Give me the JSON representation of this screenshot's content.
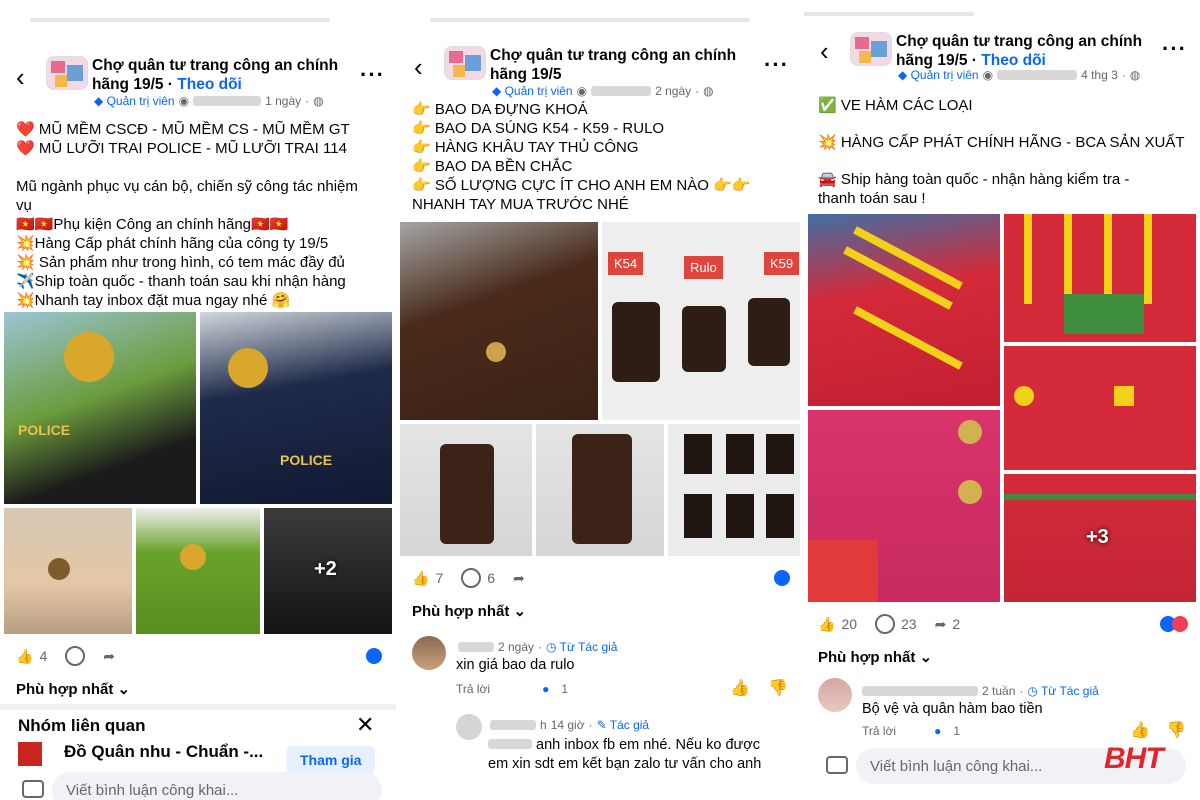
{
  "posts": [
    {
      "group_name_line1": "Chợ quân tư trang công an chính",
      "group_name_line2": "hãng 19/5",
      "follow": "Theo dõi",
      "admin": "Quản trị viên",
      "time": "1 ngày",
      "text": [
        "❤️ MŨ MỀM CSCĐ - MŨ MỀM CS - MŨ MỀM GT",
        "❤️ MŨ LƯỠI TRAI POLICE - MŨ LƯỠI TRAI 114",
        "",
        "Mũ ngành phục vụ cán bộ, chiến sỹ công tác nhiệm",
        "vụ",
        "🇻🇳🇻🇳Phụ kiện Công an chính hãng🇻🇳🇻🇳",
        "💥Hàng Cấp phát chính hãng của công ty 19/5",
        "💥 Sản phẩm như trong hình, có tem mác đầy đủ",
        "✈️Ship toàn quốc - thanh toán sau khi nhận hàng",
        "💥Nhanh tay inbox đặt mua ngay nhé 🤗"
      ],
      "extra_photos": "+2",
      "likes": "4",
      "sort": "Phù hợp nhất",
      "related_title": "Nhóm liên quan",
      "related_group": "Đồ Quân nhu - Chuẩn -...",
      "join": "Tham gia",
      "composer": "Viết bình luận công khai..."
    },
    {
      "group_name_line1": "Chợ quân tư trang công an chính",
      "group_name_line2": "hãng 19/5",
      "admin": "Quản trị viên",
      "time": "2 ngày",
      "text": [
        "👉 BAO DA ĐỰNG KHOÁ",
        "👉 BAO DA SÚNG K54 - K59 - RULO",
        "👉 HÀNG KHÂU TAY THỦ CÔNG",
        "👉 BAO DA BỀN CHẮC",
        "👉 SỐ LƯỢNG CỰC ÍT CHO ANH EM NÀO 👉👉",
        "NHANH TAY MUA TRƯỚC NHÉ"
      ],
      "labels": [
        "K54",
        "Rulo",
        "K59"
      ],
      "likes": "7",
      "comments": "6",
      "sort": "Phù hợp nhất",
      "comment1": {
        "time": "2 ngày",
        "tag": "Từ Tác giả",
        "text": "xin giá bao da rulo",
        "reply": "Trả lời",
        "likes": "1"
      },
      "comment2": {
        "time": "14 giờ",
        "tag": "Tác giả",
        "text_line1": "anh inbox fb em nhé. Nếu ko được",
        "text_line2": "em xin sdt em kết bạn zalo tư vấn cho anh"
      }
    },
    {
      "group_name_line1": "Chợ quân tư trang công an chính",
      "group_name_line2": "hãng 19/5",
      "follow": "Theo dõi",
      "admin": "Quản trị viên",
      "time": "4 thg 3",
      "text": [
        "✅ VE HÀM CÁC LOẠI",
        "",
        "💥 HÀNG CẤP PHÁT CHÍNH HÃNG - BCA SẢN XUẤT",
        "",
        "🚘 Ship hàng toàn quốc - nhận hàng kiểm tra -",
        "thanh toán sau !"
      ],
      "extra_photos": "+3",
      "likes": "20",
      "comments": "23",
      "shares": "2",
      "sort": "Phù hợp nhất",
      "comment1": {
        "time": "2 tuần",
        "tag": "Từ Tác giả",
        "text": "Bộ vệ và quân hàm bao tiền",
        "reply": "Trả lời",
        "likes": "1"
      },
      "composer": "Viết bình luận công khai..."
    }
  ],
  "watermark": "BHT"
}
